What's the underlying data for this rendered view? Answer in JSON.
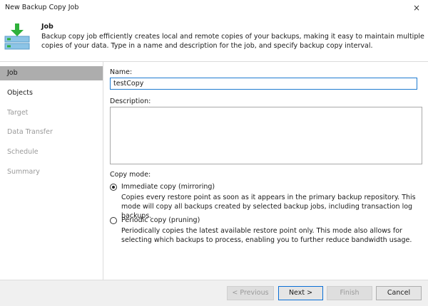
{
  "window": {
    "title": "New Backup Copy Job",
    "close_glyph": "×"
  },
  "header": {
    "icon": "backup-copy-job-icon",
    "title": "Job",
    "description": "Backup copy job efficiently creates local and remote copies of your backups, making it easy to maintain multiple copies of your data. Type in a name and description for the job, and specify backup copy interval."
  },
  "sidebar": {
    "items": [
      {
        "label": "Job",
        "state": "active"
      },
      {
        "label": "Objects",
        "state": "enabled"
      },
      {
        "label": "Target",
        "state": "disabled"
      },
      {
        "label": "Data Transfer",
        "state": "disabled"
      },
      {
        "label": "Schedule",
        "state": "disabled"
      },
      {
        "label": "Summary",
        "state": "disabled"
      }
    ]
  },
  "form": {
    "name_label": "Name:",
    "name_value": "testCopy",
    "description_label": "Description:",
    "description_value": "",
    "copy_mode_label": "Copy mode:",
    "modes": [
      {
        "label": "Immediate copy (mirroring)",
        "selected": true,
        "description": "Copies every restore point as soon as it appears in the primary backup repository. This mode will copy all backups created by selected backup jobs, including transaction log backups."
      },
      {
        "label": "Periodic copy (pruning)",
        "selected": false,
        "description": "Periodically copies the latest available restore point only. This mode also allows for selecting which backups to process, enabling you to further reduce bandwidth usage."
      }
    ]
  },
  "footer": {
    "previous_label": "< Previous",
    "next_label": "Next >",
    "finish_label": "Finish",
    "cancel_label": "Cancel"
  },
  "colors": {
    "sidebar_active": "#adadad",
    "focus_border": "#1e7bd0",
    "icon_green": "#2eb03a",
    "icon_blue": "#8cc4e6"
  }
}
